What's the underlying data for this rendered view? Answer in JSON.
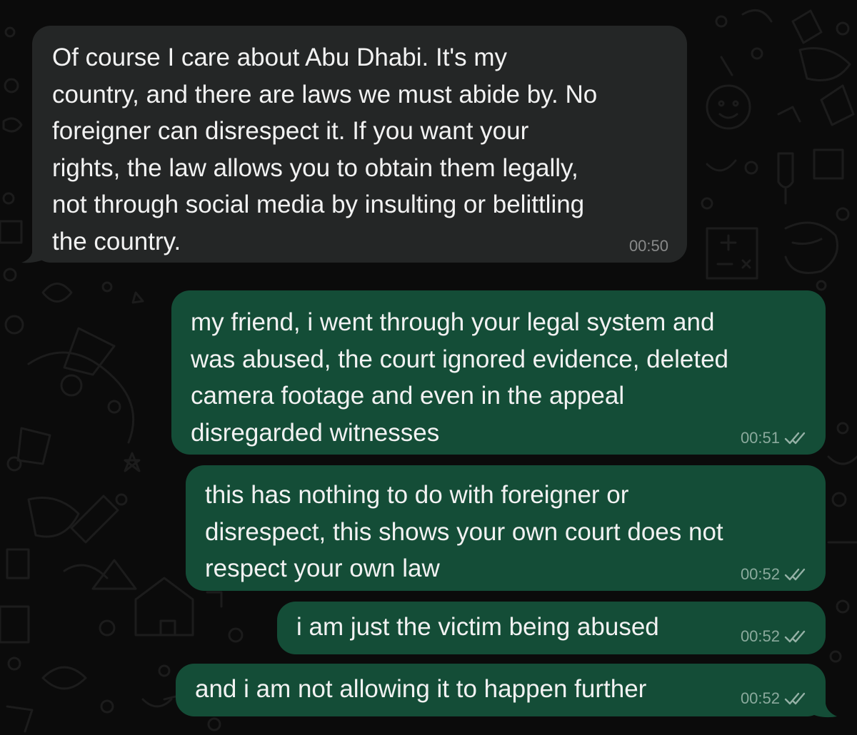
{
  "messages": [
    {
      "direction": "incoming",
      "text": "Of course I care about Abu Dhabi. It's my\ncountry, and there are laws we must abide by. No\nforeigner can disrespect it. If you want your\nrights, the law allows you to obtain them legally,\nnot through social media by insulting or belittling\nthe country.",
      "time": "00:50"
    },
    {
      "direction": "outgoing",
      "text": "my friend, i went through your legal system and\nwas abused, the court ignored evidence, deleted\ncamera footage and even in the appeal\ndisregarded witnesses",
      "time": "00:51",
      "status_icon": "double-check-icon"
    },
    {
      "direction": "outgoing",
      "text": "this has nothing to do with foreigner or\ndisrespect, this shows your own court does not\nrespect your own law",
      "time": "00:52",
      "status_icon": "double-check-icon"
    },
    {
      "direction": "outgoing",
      "text": "i am just the victim being abused",
      "time": "00:52",
      "status_icon": "double-check-icon"
    },
    {
      "direction": "outgoing",
      "text": "and i am not allowing it to happen further",
      "time": "00:52",
      "status_icon": "double-check-icon"
    }
  ],
  "colors": {
    "background": "#0b0b0b",
    "incoming_bubble": "#242626",
    "outgoing_bubble": "#144d37",
    "message_text": "#f2f2f2",
    "timestamp": "#9aa5a0"
  }
}
